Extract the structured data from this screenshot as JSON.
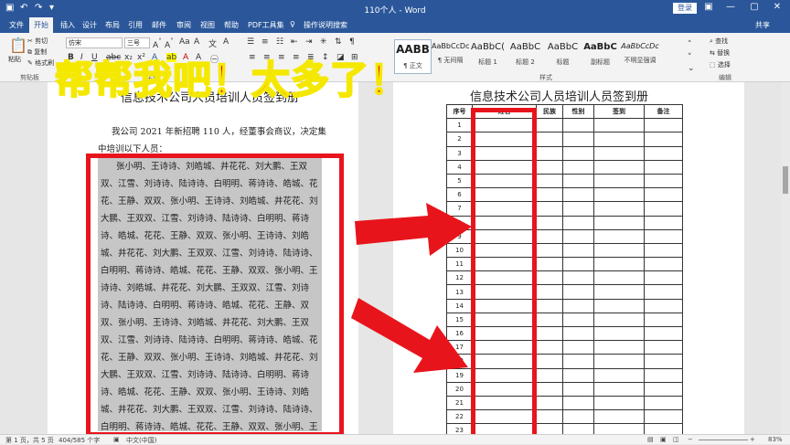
{
  "titlebar": {
    "doc_title": "110个人 - Word",
    "login_label": "登录",
    "minimize": "—",
    "restore": "▢",
    "close": "✕",
    "save_icon": "save-icon",
    "undo_icon": "undo-icon",
    "redo_icon": "redo-icon",
    "customize_icon": "customize-icon"
  },
  "tabs": [
    "文件",
    "开始",
    "插入",
    "设计",
    "布局",
    "引用",
    "邮件",
    "审阅",
    "视图",
    "帮助",
    "PDF工具集"
  ],
  "lightbulb_icon": "lightbulb-icon",
  "search_hint": "操作说明搜索",
  "share_label": "共享",
  "clipboard": {
    "paste": "粘贴",
    "cut": "剪切",
    "copy": "复制",
    "format_painter": "格式刷",
    "group_label": "剪贴板"
  },
  "font": {
    "font_name": "仿宋",
    "font_size": "三号",
    "group_label": "字体"
  },
  "paragraph": {
    "group_label": "段落"
  },
  "styles": {
    "group_label": "样式",
    "items": [
      {
        "sample": "AABB",
        "name": "¶ 正文"
      },
      {
        "sample": "AaBbCcDc",
        "name": "¶ 无间隔"
      },
      {
        "sample": "AaBbC(",
        "name": "标题 1"
      },
      {
        "sample": "AaBbC",
        "name": "标题 2"
      },
      {
        "sample": "AaBbC",
        "name": "标题"
      },
      {
        "sample": "AaBbC",
        "name": "副标题"
      },
      {
        "sample": "AaBbCcDc",
        "name": "不明显强调"
      }
    ]
  },
  "editing": {
    "find": "查找",
    "replace": "替换",
    "select": "选择",
    "group_label": "编辑"
  },
  "banner": "帮帮我吧！太多了！",
  "left_page": {
    "title": "信息技术公司人员培训人员签到册",
    "intro_line1": "我公司 2021 年新招聘 110 人，经董事会商议，决定集",
    "intro_line2": "中培训以下人员：",
    "name_lines": [
      "张小明、王诗诗、刘皓城、井花花、刘大鹏、王双",
      "双、江雪、刘诗诗、陆诗诗、白明明、蒋诗诗、皓城、花",
      "花、王静、双双、张小明、王诗诗、刘皓城、井花花、刘",
      "大鹏、王双双、江雪、刘诗诗、陆诗诗、白明明、蒋诗",
      "诗、皓城、花花、王静、双双、张小明、王诗诗、刘皓",
      "城、井花花、刘大鹏、王双双、江雪、刘诗诗、陆诗诗、",
      "白明明、蒋诗诗、皓城、花花、王静、双双、张小明、王",
      "诗诗、刘皓城、井花花、刘大鹏、王双双、江雪、刘诗",
      "诗、陆诗诗、白明明、蒋诗诗、皓城、花花、王静、双",
      "双、张小明、王诗诗、刘皓城、井花花、刘大鹏、王双",
      "双、江雪、刘诗诗、陆诗诗、白明明、蒋诗诗、皓城、花",
      "花、王静、双双、张小明、王诗诗、刘皓城、井花花、刘",
      "大鹏、王双双、江雪、刘诗诗、陆诗诗、白明明、蒋诗",
      "诗、皓城、花花、王静、双双、张小明、王诗诗、刘皓",
      "城、井花花、刘大鹏、王双双、江雪、刘诗诗、陆诗诗、",
      "白明明、蒋诗诗、皓城、花花、王静、双双、张小明、王"
    ]
  },
  "right_page": {
    "title": "信息技术公司人员培训人员签到册",
    "headers": [
      "序号",
      "姓名",
      "民族",
      "性别",
      "签到",
      "备注"
    ],
    "row_numbers": [
      "1",
      "2",
      "3",
      "4",
      "5",
      "6",
      "7",
      "8",
      "9",
      "10",
      "11",
      "12",
      "13",
      "14",
      "15",
      "16",
      "17",
      "18",
      "19",
      "20",
      "21",
      "22",
      "23"
    ]
  },
  "status": {
    "page": "第 1 页，共 5 页",
    "words": "404/585 个字",
    "lang": "中文(中国)",
    "zoom": "83%"
  },
  "colors": {
    "ribbon_blue": "#2b579a",
    "annotation_red": "#e8141c",
    "annotation_yellow": "#f5e800",
    "selection_gray": "#c6c6c6"
  }
}
